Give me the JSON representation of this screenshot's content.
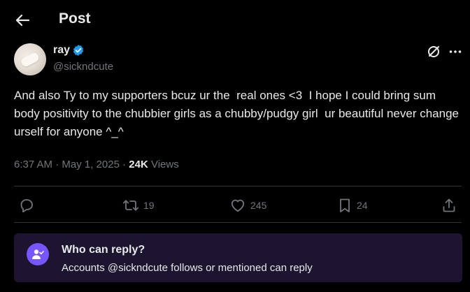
{
  "header": {
    "title": "Post",
    "back_icon": "arrow-left-icon"
  },
  "author": {
    "display_name": "ray",
    "handle": "@sickndcute",
    "verified": true,
    "verified_color": "#1d9bf0"
  },
  "tweet": {
    "text": "And also Ty to my supporters bcuz ur the  real ones <3  I hope I could bring sum body positivity to the chubbier girls as a chubby/pudgy girl  ur beautiful never change urself for anyone ^_^",
    "time": "6:37 AM",
    "separator": " · ",
    "date": "May 1, 2025",
    "views_count": "24K",
    "views_label": " Views"
  },
  "actions": {
    "reply_icon": "reply-icon",
    "repost_icon": "repost-icon",
    "repost_count": "19",
    "like_icon": "like-icon",
    "like_count": "245",
    "bookmark_icon": "bookmark-icon",
    "bookmark_count": "24",
    "share_icon": "share-icon"
  },
  "reply_restriction": {
    "title": "Who can reply?",
    "description": "Accounts @sickndcute follows or mentioned can reply",
    "accent": "#7856ff",
    "background": "#1d1530"
  },
  "colors": {
    "background": "#000000",
    "text_primary": "#e7e9ea",
    "text_secondary": "#71767b",
    "divider": "#2f3336"
  }
}
